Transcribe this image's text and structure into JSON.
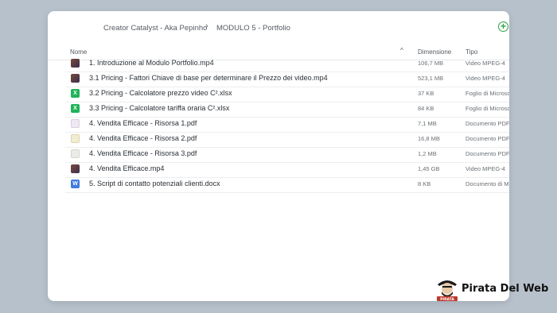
{
  "breadcrumb": {
    "parent": "Creator Catalyst - Aka Pepinho",
    "current": "MODULO 5 - Portfolio"
  },
  "columns": {
    "name": "Nome",
    "size": "Dimensione",
    "type": "Tipo"
  },
  "files": [
    {
      "name": "1. Introduzione al Modulo Portfolio.mp4",
      "size": "106,7 MB",
      "type": "Video MPEG-4",
      "icon": "video-icon"
    },
    {
      "name": "3.1 Pricing - Fattori Chiave di base per determinare il Prezzo dei video.mp4",
      "size": "523,1 MB",
      "type": "Video MPEG-4",
      "icon": "video-icon"
    },
    {
      "name": "3.2 Pricing - Calcolatore prezzo video C².xlsx",
      "size": "37 KB",
      "type": "Foglio di Microso",
      "icon": "excel-icon"
    },
    {
      "name": "3.3 Pricing - Calcolatore tariffa oraria C².xlsx",
      "size": "84 KB",
      "type": "Foglio di Microso",
      "icon": "excel-icon"
    },
    {
      "name": "4. Vendita Efficace - Risorsa 1.pdf",
      "size": "7,1 MB",
      "type": "Documento PDF",
      "icon": "pdf-icon"
    },
    {
      "name": "4. Vendita Efficace - Risorsa 2.pdf",
      "size": "16,8 MB",
      "type": "Documento PDF",
      "icon": "pdf-icon"
    },
    {
      "name": "4. Vendita Efficace - Risorsa 3.pdf",
      "size": "1,2 MB",
      "type": "Documento PDF",
      "icon": "pdf-icon"
    },
    {
      "name": "4. Vendita Efficace.mp4",
      "size": "1,45 GB",
      "type": "Video MPEG-4",
      "icon": "video-icon"
    },
    {
      "name": "5. Script di contatto potenziali clienti.docx",
      "size": "8 KB",
      "type": "Documento di M",
      "icon": "word-icon"
    }
  ],
  "watermark": {
    "text": "Pirata Del Web",
    "badge": "PIRATA"
  }
}
